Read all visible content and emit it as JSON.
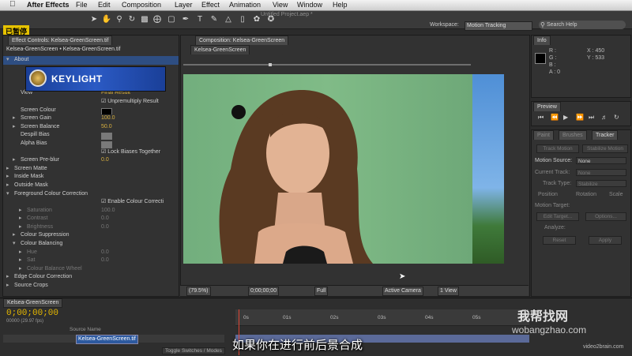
{
  "menubar": {
    "app": "After Effects",
    "items": [
      "File",
      "Edit",
      "Composition",
      "Layer",
      "Effect",
      "Animation",
      "View",
      "Window",
      "Help"
    ]
  },
  "window_title": "Untitled Project.aep *",
  "paused_label": "已暂停",
  "workspace": {
    "label": "Workspace:",
    "value": "Motion Tracking"
  },
  "search": {
    "placeholder": "Search Help"
  },
  "effect_controls": {
    "tab": "Effect Controls: Kelsea-GreenScreen.tif",
    "path": "Kelsea-GreenScreen • Kelsea-GreenScreen.tif",
    "logo_text": "KEYLIGHT",
    "rows": [
      {
        "label": "About",
        "indent": 0,
        "tri": "▾"
      },
      {
        "label": "",
        "indent": 0,
        "tri": ""
      },
      {
        "label": "",
        "indent": 0,
        "tri": ""
      },
      {
        "label": "",
        "indent": 0,
        "tri": ""
      },
      {
        "label": "View",
        "indent": 1,
        "tri": "",
        "value": "Final Result"
      },
      {
        "label": "",
        "indent": 1,
        "tri": "",
        "check": "Unpremultiply Result"
      },
      {
        "label": "Screen Colour",
        "indent": 1,
        "tri": "",
        "swatch": "black"
      },
      {
        "label": "Screen Gain",
        "indent": 1,
        "tri": "▸",
        "value": "100.0"
      },
      {
        "label": "Screen Balance",
        "indent": 1,
        "tri": "▸",
        "value": "50.0"
      },
      {
        "label": "Despill Bias",
        "indent": 1,
        "tri": "",
        "swatch": "gray"
      },
      {
        "label": "Alpha Bias",
        "indent": 1,
        "tri": "",
        "swatch": "gray"
      },
      {
        "label": "",
        "indent": 1,
        "tri": "",
        "check": "Lock Biases Together"
      },
      {
        "label": "Screen Pre-blur",
        "indent": 1,
        "tri": "▸",
        "value": "0.0"
      },
      {
        "label": "Screen Matte",
        "indent": 0,
        "tri": "▸"
      },
      {
        "label": "Inside Mask",
        "indent": 0,
        "tri": "▸"
      },
      {
        "label": "Outside Mask",
        "indent": 0,
        "tri": "▸"
      },
      {
        "label": "Foreground Colour Correction",
        "indent": 0,
        "tri": "▾"
      },
      {
        "label": "",
        "indent": 1,
        "tri": "",
        "check": "Enable Colour Correcti"
      },
      {
        "label": "Saturation",
        "indent": 2,
        "tri": "▸",
        "value": "100.0",
        "dim": true
      },
      {
        "label": "Contrast",
        "indent": 2,
        "tri": "▸",
        "value": "0.0",
        "dim": true
      },
      {
        "label": "Brightness",
        "indent": 2,
        "tri": "▸",
        "value": "0.0",
        "dim": true
      },
      {
        "label": "Colour Suppression",
        "indent": 1,
        "tri": "▸"
      },
      {
        "label": "Colour Balancing",
        "indent": 1,
        "tri": "▾"
      },
      {
        "label": "Hue",
        "indent": 2,
        "tri": "▸",
        "value": "0.0",
        "dim": true
      },
      {
        "label": "Sat",
        "indent": 2,
        "tri": "▸",
        "value": "0.0",
        "dim": true
      },
      {
        "label": "Colour Balance Wheel",
        "indent": 2,
        "tri": "▸",
        "dim": true
      },
      {
        "label": "Edge Colour Correction",
        "indent": 0,
        "tri": "▸"
      },
      {
        "label": "Source Crops",
        "indent": 0,
        "tri": "▸"
      }
    ]
  },
  "composition": {
    "tab": "Composition: Kelsea-GreenScreen",
    "subtab": "Kelsea-GreenScreen",
    "bottom": {
      "zoom": "(79.5%)",
      "time": "0;00;00;00",
      "res": "Full",
      "camera": "Active Camera",
      "views": "1 View"
    }
  },
  "info": {
    "tab": "Info",
    "r": "R :",
    "g": "G :",
    "b": "B :",
    "a": "A : 0",
    "x": "X : 450",
    "y": "Y : 533"
  },
  "preview": {
    "tab": "Preview"
  },
  "tracker": {
    "tabs": [
      "Paint",
      "Brushes",
      "Tracker"
    ],
    "track_motion": "Track Motion",
    "stabilize": "Stabilize Motion",
    "motion_source_label": "Motion Source:",
    "motion_source": "None",
    "current_track_label": "Current Track:",
    "current_track": "None",
    "track_type_label": "Track Type:",
    "track_type": "Stabilize",
    "position": "Position",
    "rotation": "Rotation",
    "scale": "Scale",
    "motion_target": "Motion Target:",
    "edit_target": "Edit Target...",
    "options": "Options...",
    "analyze": "Analyze:",
    "reset": "Reset",
    "apply": "Apply"
  },
  "timeline": {
    "tab": "Kelsea-GreenScreen",
    "timecode": "0;00;00;00",
    "sub": "00000 (29.97 fps)",
    "source_name_header": "Source Name",
    "layer_name": "Kelsea-GreenScreen.tif",
    "ticks": [
      "0s",
      "01s",
      "02s",
      "03s",
      "04s",
      "05s",
      "06"
    ],
    "toggle": "Toggle Switches / Modes"
  },
  "subtitle": "如果你在进行前后景合成",
  "watermark": {
    "brand": "我帮找网",
    "url": "wobangzhao.com",
    "video2brain": "video2brain.com"
  }
}
